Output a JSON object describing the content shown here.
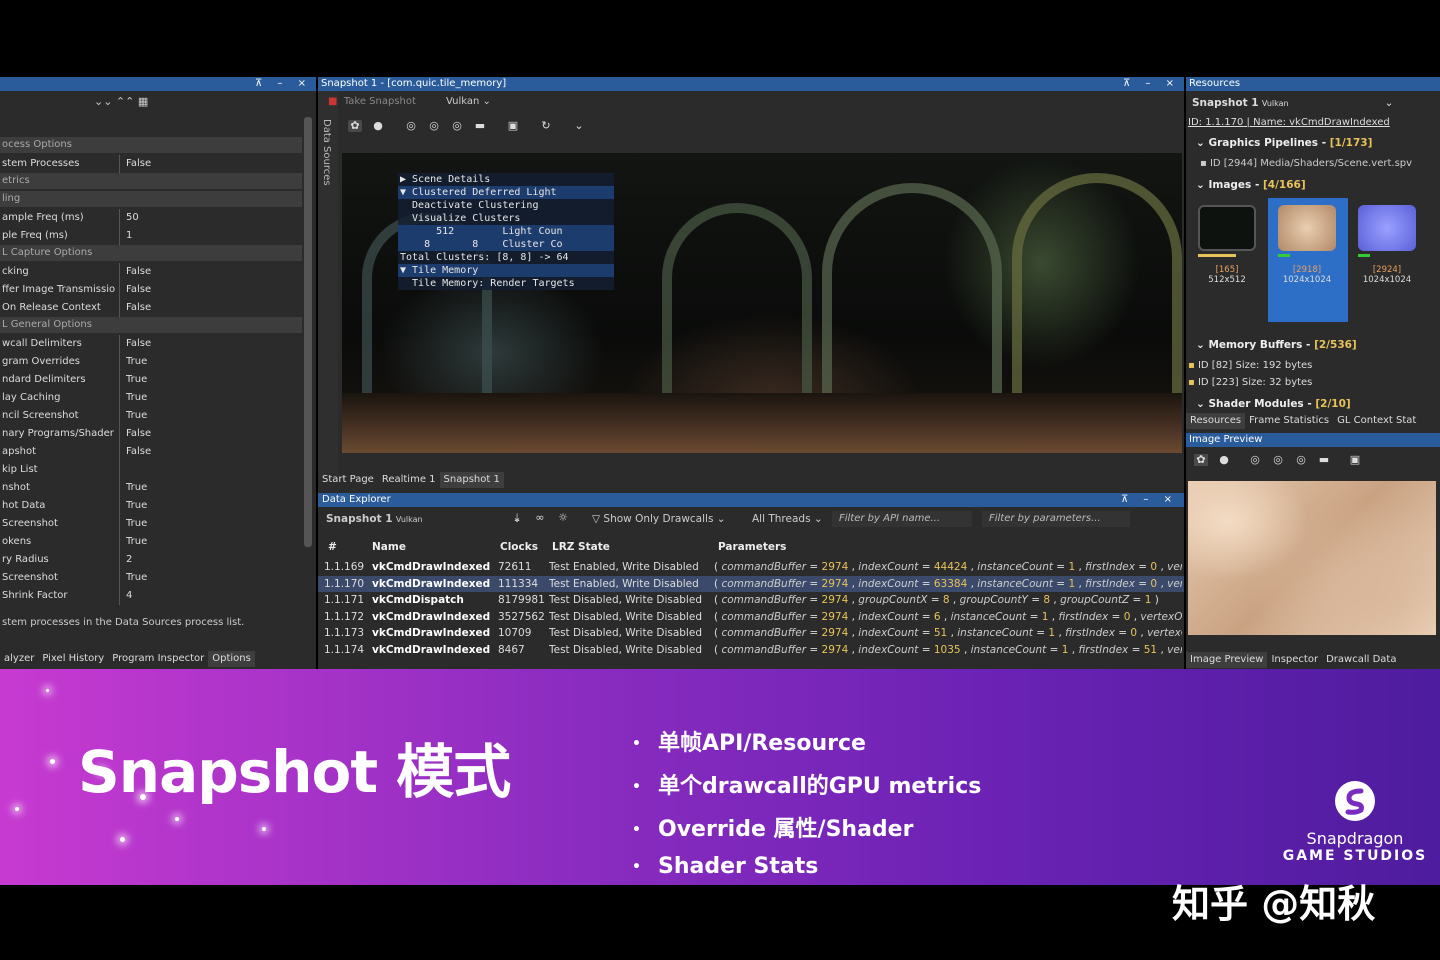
{
  "left_panel": {
    "sections": [
      {
        "type": "header",
        "text": "ocess Options"
      },
      {
        "type": "row",
        "k": "stem Processes",
        "v": "False"
      },
      {
        "type": "header",
        "text": "etrics"
      },
      {
        "type": "header",
        "text": "ling"
      },
      {
        "type": "row",
        "k": "ample Freq (ms)",
        "v": "50"
      },
      {
        "type": "row",
        "k": "ple Freq (ms)",
        "v": "1"
      },
      {
        "type": "header",
        "text": "L Capture Options"
      },
      {
        "type": "row",
        "k": "cking",
        "v": "False"
      },
      {
        "type": "row",
        "k": "ffer Image Transmissio",
        "v": "False"
      },
      {
        "type": "row",
        "k": "On Release Context",
        "v": "False"
      },
      {
        "type": "header",
        "text": "L General Options"
      },
      {
        "type": "row",
        "k": "wcall Delimiters",
        "v": "False"
      },
      {
        "type": "row",
        "k": "gram Overrides",
        "v": "True"
      },
      {
        "type": "row",
        "k": "ndard Delimiters",
        "v": "True"
      },
      {
        "type": "row",
        "k": "lay Caching",
        "v": "True"
      },
      {
        "type": "row",
        "k": "ncil Screenshot",
        "v": "True"
      },
      {
        "type": "row",
        "k": "nary Programs/Shader",
        "v": "False"
      },
      {
        "type": "row",
        "k": "apshot",
        "v": "False"
      },
      {
        "type": "row",
        "k": "kip List",
        "v": ""
      },
      {
        "type": "row",
        "k": "nshot",
        "v": "True"
      },
      {
        "type": "row",
        "k": "hot Data",
        "v": "True"
      },
      {
        "type": "row",
        "k": "Screenshot",
        "v": "True"
      },
      {
        "type": "row",
        "k": "okens",
        "v": "True"
      },
      {
        "type": "row",
        "k": "ry Radius",
        "v": "2"
      },
      {
        "type": "row",
        "k": "Screenshot",
        "v": "True"
      },
      {
        "type": "row",
        "k": "Shrink Factor",
        "v": "4"
      }
    ],
    "description": "stem processes in the Data Sources process list.",
    "tabs": [
      "alyzer",
      "Pixel History",
      "Program Inspector",
      "Options"
    ]
  },
  "center": {
    "title": "Snapshot 1 - [com.quic.tile_memory]",
    "side_label": "Data Sources",
    "take_snapshot": "Take Snapshot",
    "api": "Vulkan",
    "overlay": [
      "▶ Scene Details",
      "▼ Clustered Deferred Light",
      "  Deactivate Clustering",
      "  Visualize Clusters",
      "      512        Light Coun",
      "    8       8    Cluster Co",
      "Total Clusters: [8, 8] -> 64",
      "▼ Tile Memory",
      "  Tile Memory: Render Targets"
    ],
    "view_tabs": [
      "Start Page",
      "Realtime 1",
      "Snapshot 1"
    ],
    "explorer": {
      "title": "Data Explorer",
      "snapshot": "Snapshot 1",
      "api": "Vulkan",
      "filter_drawcalls": "Show Only Drawcalls",
      "threads": "All Threads",
      "filter_api": "Filter by API name...",
      "filter_params": "Filter by parameters...",
      "columns": [
        "#",
        "Name",
        "Clocks",
        "LRZ State",
        "Parameters"
      ],
      "rows": [
        {
          "id": "1.1.169",
          "name": "vkCmdDrawIndexed",
          "clocks": "72611",
          "lrz": "Test Enabled, Write Disabled",
          "p": [
            [
              "commandBuffer",
              "2974"
            ],
            [
              "indexCount",
              "44424"
            ],
            [
              "instanceCount",
              "1"
            ],
            [
              "firstIndex",
              "0"
            ],
            [
              "vertexOffs",
              ""
            ]
          ]
        },
        {
          "id": "1.1.170",
          "name": "vkCmdDrawIndexed",
          "clocks": "111334",
          "lrz": "Test Enabled, Write Disabled",
          "p": [
            [
              "commandBuffer",
              "2974"
            ],
            [
              "indexCount",
              "63384"
            ],
            [
              "instanceCount",
              "1"
            ],
            [
              "firstIndex",
              "0"
            ],
            [
              "vertexOffs",
              ""
            ]
          ]
        },
        {
          "id": "1.1.171",
          "name": "vkCmdDispatch",
          "clocks": "8179981",
          "lrz": "Test Disabled, Write Disabled",
          "p": [
            [
              "commandBuffer",
              "2974"
            ],
            [
              "groupCountX",
              "8"
            ],
            [
              "groupCountY",
              "8"
            ],
            [
              "groupCountZ",
              "1"
            ]
          ]
        },
        {
          "id": "1.1.172",
          "name": "vkCmdDrawIndexed",
          "clocks": "3527562",
          "lrz": "Test Disabled, Write Disabled",
          "p": [
            [
              "commandBuffer",
              "2974"
            ],
            [
              "indexCount",
              "6"
            ],
            [
              "instanceCount",
              "1"
            ],
            [
              "firstIndex",
              "0"
            ],
            [
              "vertexOffset",
              "("
            ]
          ]
        },
        {
          "id": "1.1.173",
          "name": "vkCmdDrawIndexed",
          "clocks": "10709",
          "lrz": "Test Disabled, Write Disabled",
          "p": [
            [
              "commandBuffer",
              "2974"
            ],
            [
              "indexCount",
              "51"
            ],
            [
              "instanceCount",
              "1"
            ],
            [
              "firstIndex",
              "0"
            ],
            [
              "vertexOffset",
              ""
            ]
          ]
        },
        {
          "id": "1.1.174",
          "name": "vkCmdDrawIndexed",
          "clocks": "8467",
          "lrz": "Test Disabled, Write Disabled",
          "p": [
            [
              "commandBuffer",
              "2974"
            ],
            [
              "indexCount",
              "1035"
            ],
            [
              "instanceCount",
              "1"
            ],
            [
              "firstIndex",
              "51"
            ],
            [
              "vertexOffs",
              ""
            ]
          ]
        }
      ],
      "selected_index": 1
    }
  },
  "right": {
    "title": "Resources",
    "snapshot": "Snapshot 1",
    "api": "Vulkan",
    "id_line": "ID: 1.1.170 | Name: vkCmdDrawIndexed",
    "pipelines": {
      "label": "Graphics Pipelines - ",
      "count": "[1/173]",
      "item": "ID [2944]  Media/Shaders/Scene.vert.spv"
    },
    "images": {
      "label": "Images - ",
      "count": "[4/166]",
      "items": [
        {
          "id": "[165]",
          "size": "512x512"
        },
        {
          "id": "[2918]",
          "size": "1024x1024"
        },
        {
          "id": "[2924]",
          "size": "1024x1024"
        }
      ]
    },
    "buffers": {
      "label": "Memory Buffers - ",
      "count": "[2/536]",
      "items": [
        "ID [82] Size: 192 bytes",
        "ID [223] Size: 32 bytes"
      ]
    },
    "shaders": {
      "label": "Shader Modules - ",
      "count": "[2/10]"
    },
    "tabs": [
      "Resources",
      "Frame Statistics",
      "GL Context Stat"
    ],
    "preview_title": "Image Preview",
    "bottom_tabs": [
      "Image Preview",
      "Inspector",
      "Drawcall Data"
    ]
  },
  "banner": {
    "title": "Snapshot 模式",
    "bullets": [
      "单帧API/Resource",
      "单个drawcall的GPU metrics",
      "Override 属性/Shader",
      "Shader Stats"
    ],
    "logo_line1": "Snapdragon",
    "logo_line2": "GAME STUDIOS"
  },
  "watermark": "知乎 @知秋",
  "colors": {
    "titlebar": "#2a5c9c",
    "accent": "#e8c35a",
    "banner_start": "#c73ad1",
    "banner_end": "#4e1c9e"
  }
}
